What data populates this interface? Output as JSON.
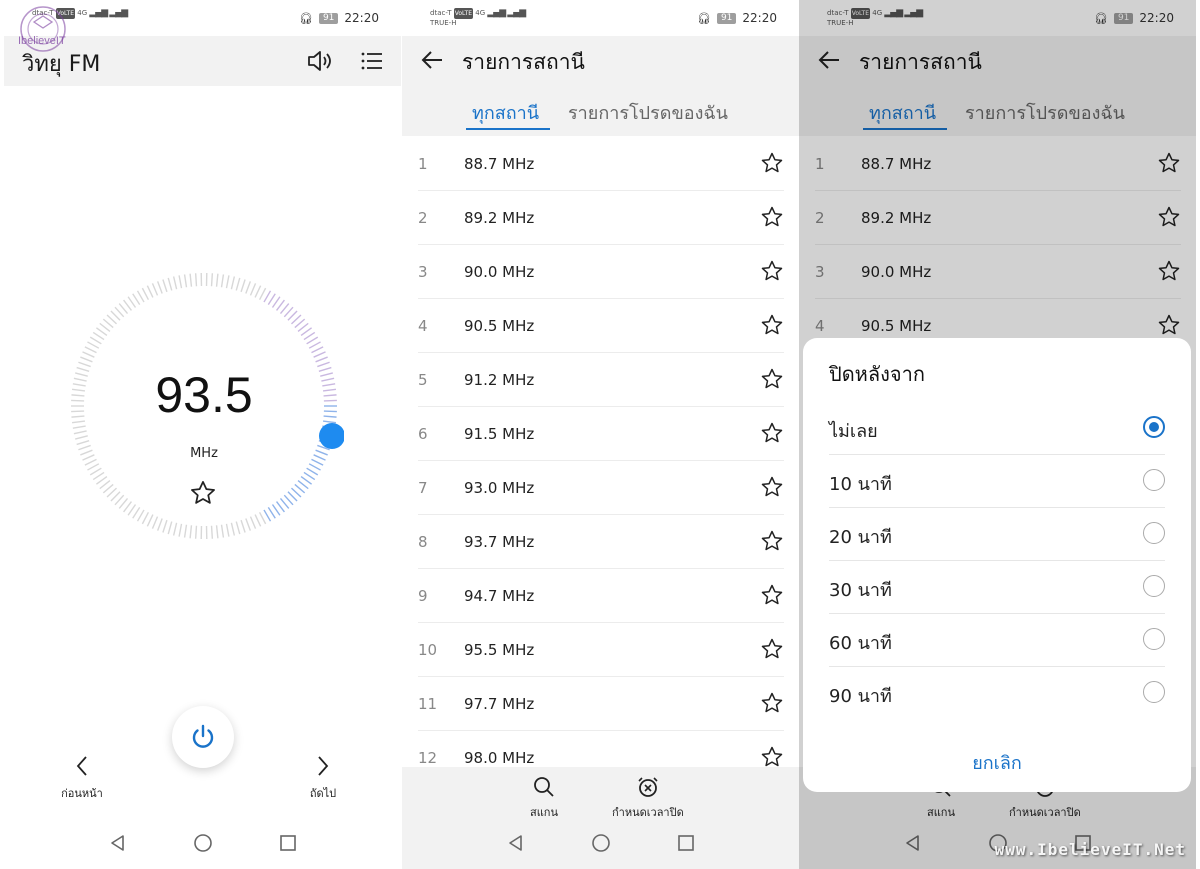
{
  "status": {
    "carrier1": "dtac-T",
    "carrier2": "TRUE-H",
    "volte": "VoLTE",
    "net": "4G",
    "battery": "91",
    "time": "22:20"
  },
  "radio": {
    "app_title": "วิทยุ FM",
    "watermark_logo": "IbelieveIT",
    "frequency": "93.5",
    "unit": "MHz",
    "prev_label": "ก่อนหน้า",
    "next_label": "ถัดไป"
  },
  "station_list": {
    "title": "รายการสถานี",
    "tab_all": "ทุกสถานี",
    "tab_fav": "รายการโปรดของฉัน",
    "stations": [
      {
        "num": "1",
        "freq": "88.7 MHz"
      },
      {
        "num": "2",
        "freq": "89.2 MHz"
      },
      {
        "num": "3",
        "freq": "90.0 MHz"
      },
      {
        "num": "4",
        "freq": "90.5 MHz"
      },
      {
        "num": "5",
        "freq": "91.2 MHz"
      },
      {
        "num": "6",
        "freq": "91.5 MHz"
      },
      {
        "num": "7",
        "freq": "93.0 MHz"
      },
      {
        "num": "8",
        "freq": "93.7 MHz"
      },
      {
        "num": "9",
        "freq": "94.7 MHz"
      },
      {
        "num": "10",
        "freq": "95.5 MHz"
      },
      {
        "num": "11",
        "freq": "97.7 MHz"
      },
      {
        "num": "12",
        "freq": "98.0 MHz"
      }
    ],
    "scan_label": "สแกน",
    "timer_label": "กำหนดเวลาปิด"
  },
  "sleep_dialog": {
    "title": "ปิดหลังจาก",
    "options": [
      {
        "label": "ไม่เลย",
        "selected": true
      },
      {
        "label": "10 นาที",
        "selected": false
      },
      {
        "label": "20 นาที",
        "selected": false
      },
      {
        "label": "30 นาที",
        "selected": false
      },
      {
        "label": "60 นาที",
        "selected": false
      },
      {
        "label": "90 นาที",
        "selected": false
      }
    ],
    "cancel_label": "ยกเลิก"
  },
  "watermark": "www.IbelieveIT.Net",
  "colors": {
    "accent": "#1a73c9",
    "knob": "#1e8bf0",
    "bar_bg": "#f2f2f2"
  }
}
